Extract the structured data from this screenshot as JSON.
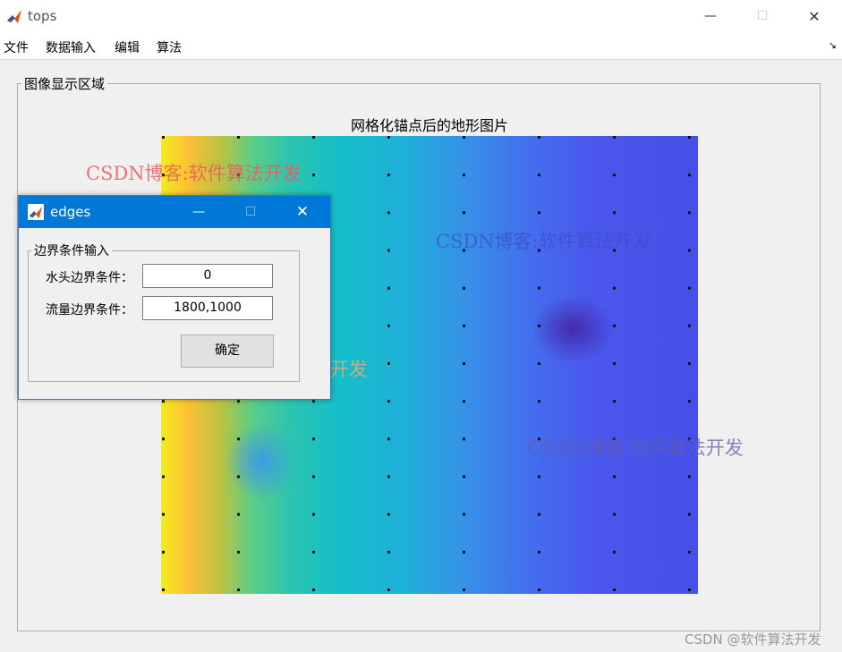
{
  "window": {
    "title": "tops",
    "icon": "matlab-icon",
    "controls": {
      "minimize": "—",
      "maximize": "☐",
      "close": "✕"
    }
  },
  "menu": {
    "items": [
      "文件",
      "数据输入",
      "编辑",
      "算法"
    ],
    "overflow_arrow": "↘"
  },
  "panel": {
    "title": "图像显示区域"
  },
  "plot": {
    "title": "网格化锚点后的地形图片",
    "colormap": "parula",
    "grid": {
      "columns": 8,
      "rows": 13
    },
    "colors": {
      "left": "#f5ec20",
      "middle": "#14bfc8",
      "right": "#4650e8",
      "low_spot": "#4428aa"
    }
  },
  "watermarks": [
    "CSDN博客:软件算法开发",
    "CSDN博客:软件算法开发",
    "CSDN博客:软件算法开发",
    "CSDN博客:软件算法开发"
  ],
  "dialog": {
    "title": "edges",
    "icon": "matlab-icon",
    "controls": {
      "minimize": "—",
      "maximize": "☐",
      "close": "✕"
    },
    "group_title": "边界条件输入",
    "fields": {
      "head_label": "水头边界条件：",
      "head_value": "0",
      "flow_label": "流量边界条件：",
      "flow_value": "1800,1000"
    },
    "ok_label": "确定"
  },
  "footer_watermark": "CSDN @软件算法开发"
}
